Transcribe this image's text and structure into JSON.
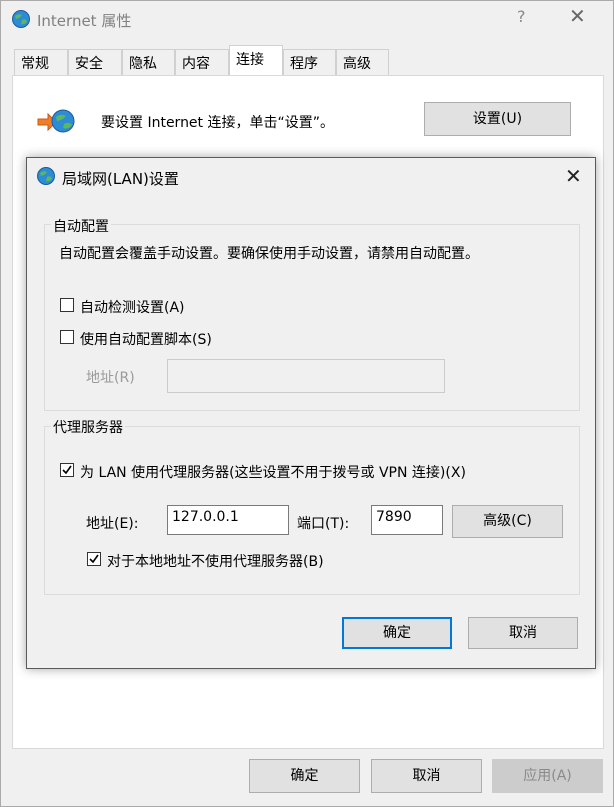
{
  "window": {
    "title": "Internet 属性",
    "help_glyph": "?",
    "close_glyph": "✕",
    "tabs": [
      "常规",
      "安全",
      "隐私",
      "内容",
      "连接",
      "程序",
      "高级"
    ],
    "active_tab": "连接",
    "connection_text": "要设置 Internet 连接，单击“设置”。",
    "setup_button": "设置(U)",
    "buttons": {
      "ok": "确定",
      "cancel": "取消",
      "apply": "应用(A)"
    }
  },
  "lan_dialog": {
    "title": "局域网(LAN)设置",
    "close_glyph": "✕",
    "auto_config": {
      "group_label": "自动配置",
      "description": "自动配置会覆盖手动设置。要确保使用手动设置，请禁用自动配置。",
      "auto_detect_label": "自动检测设置(A)",
      "auto_detect_checked": false,
      "use_script_label": "使用自动配置脚本(S)",
      "use_script_checked": false,
      "address_label": "地址(R)",
      "address_value": ""
    },
    "proxy": {
      "group_label": "代理服务器",
      "use_proxy_label": "为 LAN 使用代理服务器(这些设置不用于拨号或 VPN 连接)(X)",
      "use_proxy_checked": true,
      "address_label": "地址(E):",
      "address_value": "127.0.0.1",
      "port_label": "端口(T):",
      "port_value": "7890",
      "advanced_button": "高级(C)",
      "bypass_local_label": "对于本地地址不使用代理服务器(B)",
      "bypass_local_checked": true
    },
    "buttons": {
      "ok": "确定",
      "cancel": "取消"
    }
  },
  "colors": {
    "focus_border": "#0078d7",
    "dialog_bg": "#f0f0f0",
    "tab_panel_bg": "#ffffff"
  }
}
